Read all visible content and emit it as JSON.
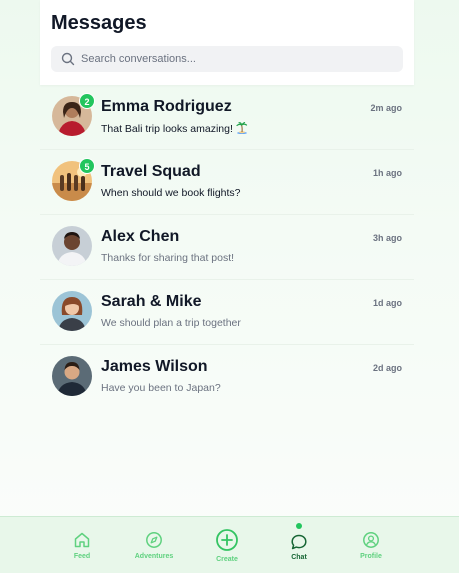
{
  "header": {
    "title": "Messages",
    "search_placeholder": "Search conversations..."
  },
  "conversations": [
    {
      "name": "Emma Rodriguez",
      "time": "2m ago",
      "preview": "That Bali trip looks amazing!",
      "preview_emoji": "palm-tree-island",
      "unread": "2"
    },
    {
      "name": "Travel Squad",
      "time": "1h ago",
      "preview": "When should we book flights?",
      "unread": "5"
    },
    {
      "name": "Alex Chen",
      "time": "3h ago",
      "preview": "Thanks for sharing that post!"
    },
    {
      "name": "Sarah & Mike",
      "time": "1d ago",
      "preview": "We should plan a trip together"
    },
    {
      "name": "James Wilson",
      "time": "2d ago",
      "preview": "Have you been to Japan?"
    }
  ],
  "tabbar": {
    "tabs": [
      {
        "label": "Feed",
        "icon": "home-icon"
      },
      {
        "label": "Adventures",
        "icon": "compass-icon"
      },
      {
        "label": "Create",
        "icon": "plus-circle-icon"
      },
      {
        "label": "Chat",
        "icon": "chat-bubble-icon",
        "active": true
      },
      {
        "label": "Profile",
        "icon": "user-circle-icon"
      }
    ]
  },
  "colors": {
    "accent": "#22c55e",
    "tab_inactive": "#5fd17f",
    "tab_active": "#166534",
    "background": "#edf9ef"
  }
}
